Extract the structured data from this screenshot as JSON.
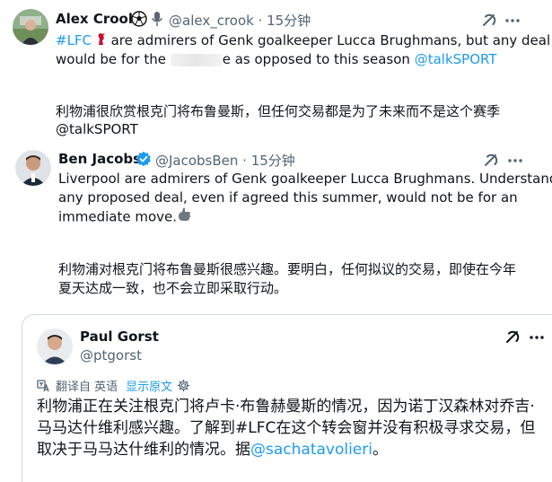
{
  "tweet1": {
    "name": "Alex Crook",
    "handle": "@alex_crook",
    "time": "15分钟",
    "text_hashtag": "#LFC",
    "text_part1": " are admirers of Genk goalkeeper Lucca Brughmans, but any deal",
    "text_part2a": "would be for the ",
    "text_part2b": "e as opposed to this season ",
    "mention": "@talkSPORT",
    "translation_line1": "利物浦很欣赏根克门将布鲁曼斯，但任何交易都是为了未来而不是这个赛季",
    "translation_line2": "@talkSPORT",
    "icons": [
      "football-icon",
      "microphone-icon",
      "grok-icon",
      "more-icon"
    ]
  },
  "tweet2": {
    "name": "Ben Jacobs",
    "handle": "@JacobsBen",
    "time": "15分钟",
    "text_line1": "Liverpool are admirers of Genk goalkeeper Lucca Brughmans. Understand",
    "text_line2": "any proposed deal, even if agreed this summer, would not be for an",
    "text_line3": "immediate move.",
    "translation_line1": "利物浦对根克门将布鲁曼斯很感兴趣。要明白，任何拟议的交易，即使在今年",
    "translation_line2": "夏天达成一致，也不会立即采取行动。",
    "icons": [
      "verified-icon",
      "grok-icon",
      "more-icon"
    ]
  },
  "quoted": {
    "name": "Paul Gorst",
    "handle": "@ptgorst",
    "translated_from": "翻译自 英语",
    "show_original": "显示原文",
    "text_line1": "利物浦正在关注根克门将卢卡·布鲁赫曼斯的情况，因为诺丁汉森林对乔吉·",
    "text_line2": "马马达什维利感兴趣。了解到#LFC在这个转会窗并没有积极寻求交易，但",
    "text_line3a": "取决于马马达什维利的情况。据",
    "mention": "@sachatavolieri",
    "text_line3b": "。"
  },
  "colors": {
    "link": "#1d9bf0",
    "text": "#0f1419",
    "secondary": "#536471",
    "border": "#cfd9de"
  }
}
